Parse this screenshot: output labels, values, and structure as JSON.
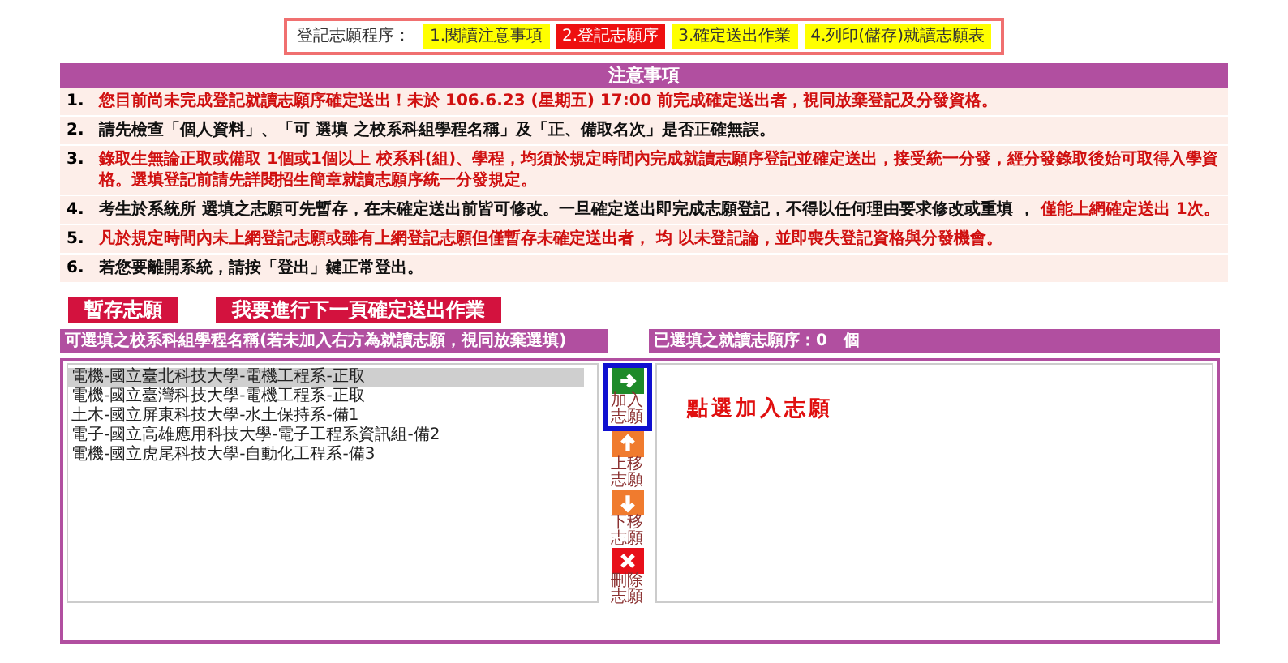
{
  "steps": {
    "label": "登記志願程序：",
    "items": [
      {
        "label": "1.閱讀注意事項",
        "selected": false
      },
      {
        "label": "2.登記志願序",
        "selected": true
      },
      {
        "label": "3.確定送出作業",
        "selected": false
      },
      {
        "label": "4.列印(儲存)就讀志願表",
        "selected": false
      }
    ]
  },
  "notice": {
    "title": "注意事項",
    "items": [
      {
        "number": "1.",
        "segments": [
          {
            "text": "您目前尚未完成登記就讀志願序確定送出！未於 106.6.23 (星期五) 17:00 前完成確定送出者，視同放棄登記及分發資格。",
            "warning": true
          }
        ]
      },
      {
        "number": "2.",
        "segments": [
          {
            "text": "請先檢查「個人資料」、「可 選填 之校系科組學程名稱」及「正、備取名次」是否正確無誤。",
            "warning": false
          }
        ]
      },
      {
        "number": "3.",
        "segments": [
          {
            "text": "錄取生無論正取或備取 1個或1個以上 校系科(組)、學程，均須於規定時間內完成就讀志願序登記並確定送出，接受統一分發，經分發錄取後始可取得入學資格。選填登記前請先詳閱招生簡章就讀志願序統一分發規定。",
            "warning": true
          }
        ]
      },
      {
        "number": "4.",
        "segments": [
          {
            "text": "考生於系統所 選填之志願可先暫存，在未確定送出前皆可修改。一旦確定送出即完成志願登記，不得以任何理由要求修改或重填 ， ",
            "warning": false
          },
          {
            "text": "僅能上網確定送出 1次。",
            "warning": true
          }
        ]
      },
      {
        "number": "5.",
        "segments": [
          {
            "text": "凡於規定時間內未上網登記志願或雖有上網登記志願但僅暫存未確定送出者， 均 以未登記論，並即喪失登記資格與分發機會。",
            "warning": true
          }
        ]
      },
      {
        "number": "6.",
        "segments": [
          {
            "text": "若您要離開系統，請按「登出」鍵正常登出。",
            "warning": false
          }
        ]
      }
    ]
  },
  "actions": [
    "暫存志願",
    "我要進行下一頁確定送出作業"
  ],
  "available": {
    "title": "可選填之校系科組學程名稱(若未加入右方為就讀志願，視同放棄選填)",
    "items": [
      {
        "label": "電機-國立臺北科技大學-電機工程系-正取",
        "selected": true
      },
      {
        "label": "電機-國立臺灣科技大學-電機工程系-正取",
        "selected": false
      },
      {
        "label": "土木-國立屏東科技大學-水土保持系-備1",
        "selected": false
      },
      {
        "label": "電子-國立高雄應用科技大學-電子工程系資訊組-備2",
        "selected": false
      },
      {
        "label": "電機-國立虎尾科技大學-自動化工程系-備3",
        "selected": false
      }
    ]
  },
  "controls": [
    {
      "kind": "add",
      "label": "加入志願",
      "highlighted": true
    },
    {
      "kind": "up",
      "label": "上移志願",
      "highlighted": false
    },
    {
      "kind": "down",
      "label": "下移志願",
      "highlighted": false
    },
    {
      "kind": "remove",
      "label": "刪除志願",
      "highlighted": false
    }
  ],
  "chosen": {
    "title": "已選填之就讀志願序：0　個",
    "hint": "點選加入志願"
  }
}
